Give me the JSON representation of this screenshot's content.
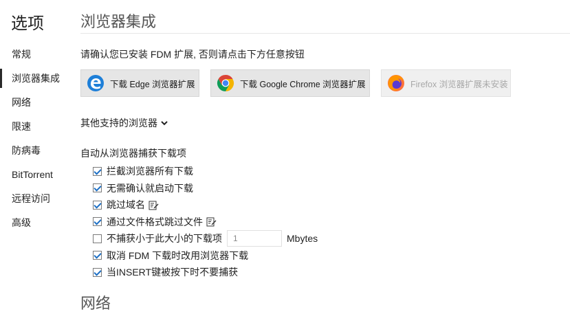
{
  "app": {
    "title": "选项"
  },
  "sidebar": {
    "items": [
      {
        "label": "常规"
      },
      {
        "label": "浏览器集成"
      },
      {
        "label": "网络"
      },
      {
        "label": "限速"
      },
      {
        "label": "防病毒"
      },
      {
        "label": "BitTorrent"
      },
      {
        "label": "远程访问"
      },
      {
        "label": "高级"
      }
    ]
  },
  "main": {
    "section_title": "浏览器集成",
    "note": "请确认您已安装 FDM 扩展, 否则请点击下方任意按钮",
    "buttons": {
      "edge": "下载 Edge 浏览器扩展",
      "chrome": "下载 Google Chrome 浏览器扩展",
      "firefox": "Firefox 浏览器扩展未安装"
    },
    "other_browsers": "其他支持的浏览器",
    "capture_title": "自动从浏览器捕获下载项",
    "options": [
      {
        "label": "拦截浏览器所有下载",
        "checked": true
      },
      {
        "label": "无需确认就启动下载",
        "checked": true
      },
      {
        "label": "跳过域名",
        "checked": true
      },
      {
        "label": "通过文件格式跳过文件",
        "checked": true
      },
      {
        "label": "不捕获小于此大小的下载项",
        "checked": false
      },
      {
        "label": "取消 FDM 下载时改用浏览器下载",
        "checked": true
      },
      {
        "label": "当INSERT键被按下时不要捕获",
        "checked": true
      }
    ],
    "min_size_value": "1",
    "min_size_unit": "Mbytes",
    "next_section_title": "网络"
  },
  "colors": {
    "accent": "#1d6fc4",
    "button_bg": "#e6e6e6",
    "disabled_text": "#a8a8a8"
  }
}
